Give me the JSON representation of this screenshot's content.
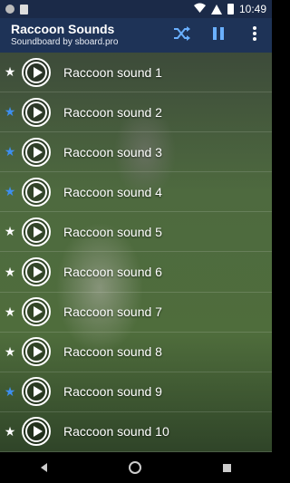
{
  "status_bar": {
    "time": "10:49"
  },
  "app_bar": {
    "title": "Raccoon Sounds",
    "subtitle": "Soundboard by sboard.pro",
    "actions": [
      "shuffle-icon",
      "pause-icon",
      "more-vert-icon"
    ]
  },
  "list": {
    "items": [
      {
        "label": "Raccoon sound 1",
        "favorite": false
      },
      {
        "label": "Raccoon sound 2",
        "favorite": true
      },
      {
        "label": "Raccoon sound 3",
        "favorite": true
      },
      {
        "label": "Raccoon sound 4",
        "favorite": true
      },
      {
        "label": "Raccoon sound 5",
        "favorite": false
      },
      {
        "label": "Raccoon sound 6",
        "favorite": false
      },
      {
        "label": "Raccoon sound 7",
        "favorite": false
      },
      {
        "label": "Raccoon sound 8",
        "favorite": false
      },
      {
        "label": "Raccoon sound 9",
        "favorite": true
      },
      {
        "label": "Raccoon sound 10",
        "favorite": false
      }
    ]
  },
  "colors": {
    "app_bar": "#1e3357",
    "favorite_star": "#3d8ff0"
  }
}
